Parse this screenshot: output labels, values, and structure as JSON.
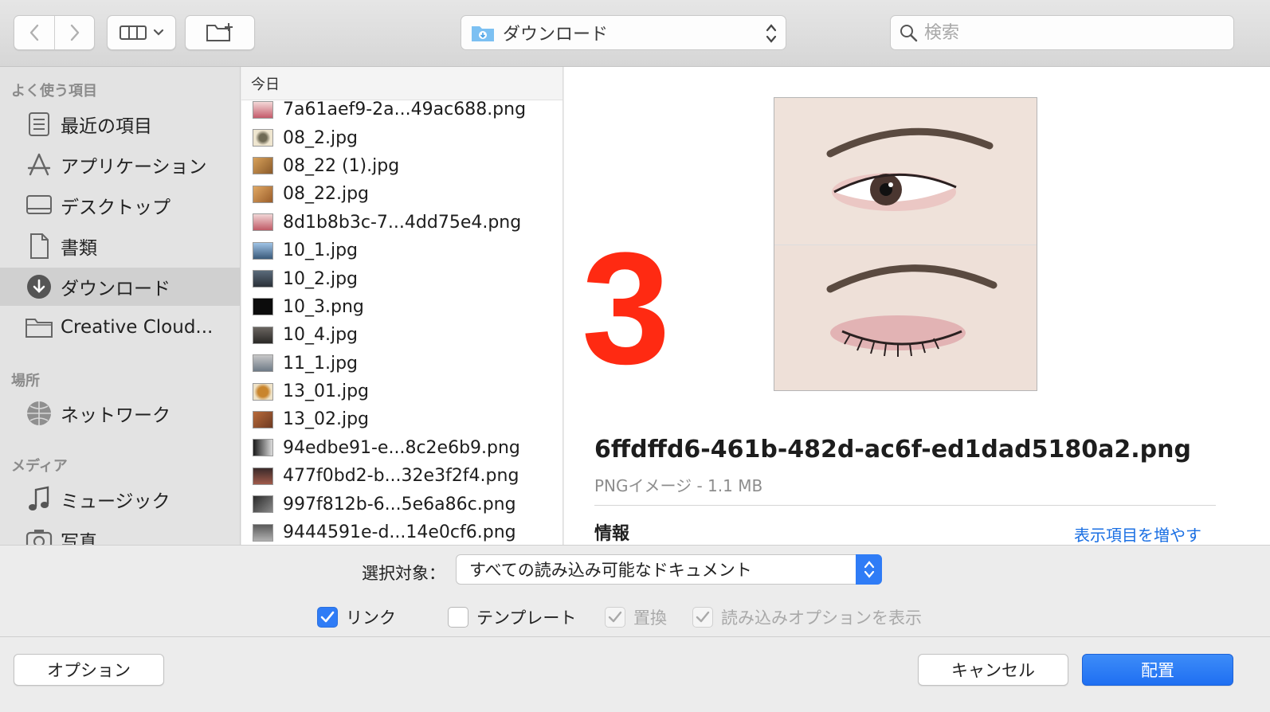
{
  "toolbar": {
    "back_icon": "chevron-left-icon",
    "forward_icon": "chevron-right-icon",
    "view_icon": "column-view-icon",
    "new_folder_icon": "new-folder-icon",
    "location_label": "ダウンロード",
    "search_placeholder": "検索"
  },
  "sidebar": {
    "favorites_title": "よく使う項目",
    "favorites": [
      {
        "label": "最近の項目",
        "icon": "recents-icon"
      },
      {
        "label": "アプリケーション",
        "icon": "applications-icon"
      },
      {
        "label": "デスクトップ",
        "icon": "desktop-icon"
      },
      {
        "label": "書類",
        "icon": "documents-icon"
      },
      {
        "label": "ダウンロード",
        "icon": "downloads-icon",
        "selected": true
      },
      {
        "label": "Creative Cloud...",
        "icon": "folder-icon"
      }
    ],
    "locations_title": "場所",
    "locations": [
      {
        "label": "ネットワーク",
        "icon": "network-icon"
      }
    ],
    "media_title": "メディア",
    "media": [
      {
        "label": "ミュージック",
        "icon": "music-icon"
      },
      {
        "label": "写真",
        "icon": "photos-icon"
      }
    ]
  },
  "filelist": {
    "header": "今日",
    "files": [
      "7a61aef9-2a...49ac688.png",
      "08_2.jpg",
      "08_22 (1).jpg",
      "08_22.jpg",
      "8d1b8b3c-7...4dd75e4.png",
      "10_1.jpg",
      "10_2.jpg",
      "10_3.png",
      "10_4.jpg",
      "11_1.jpg",
      "13_01.jpg",
      "13_02.jpg",
      "94edbe91-e...8c2e6b9.png",
      "477f0bd2-b...32e3f2f4.png",
      "997f812b-6...5e6a86c.png",
      "9444591e-d...14e0cf6.png"
    ]
  },
  "preview": {
    "annotation_number": "3",
    "annotation_color": "#ff2a12",
    "file_name": "6ffdffd6-461b-482d-ac6f-ed1dad5180a2.png",
    "file_kind": "PNGイメージ - 1.1 MB",
    "info_title": "情報",
    "show_more": "表示項目を増やす"
  },
  "accessory": {
    "select_label": "選択対象：",
    "select_value": "すべての読み込み可能なドキュメント",
    "checks": [
      {
        "label": "リンク",
        "checked": true,
        "enabled": true
      },
      {
        "label": "テンプレート",
        "checked": false,
        "enabled": true
      },
      {
        "label": "置換",
        "checked": true,
        "enabled": false
      },
      {
        "label": "読み込みオプションを表示",
        "checked": true,
        "enabled": false
      }
    ]
  },
  "footer": {
    "options_label": "オプション",
    "cancel_label": "キャンセル",
    "place_label": "配置"
  },
  "colors": {
    "accent": "#2f7cf6",
    "link": "#1a6fe3"
  }
}
